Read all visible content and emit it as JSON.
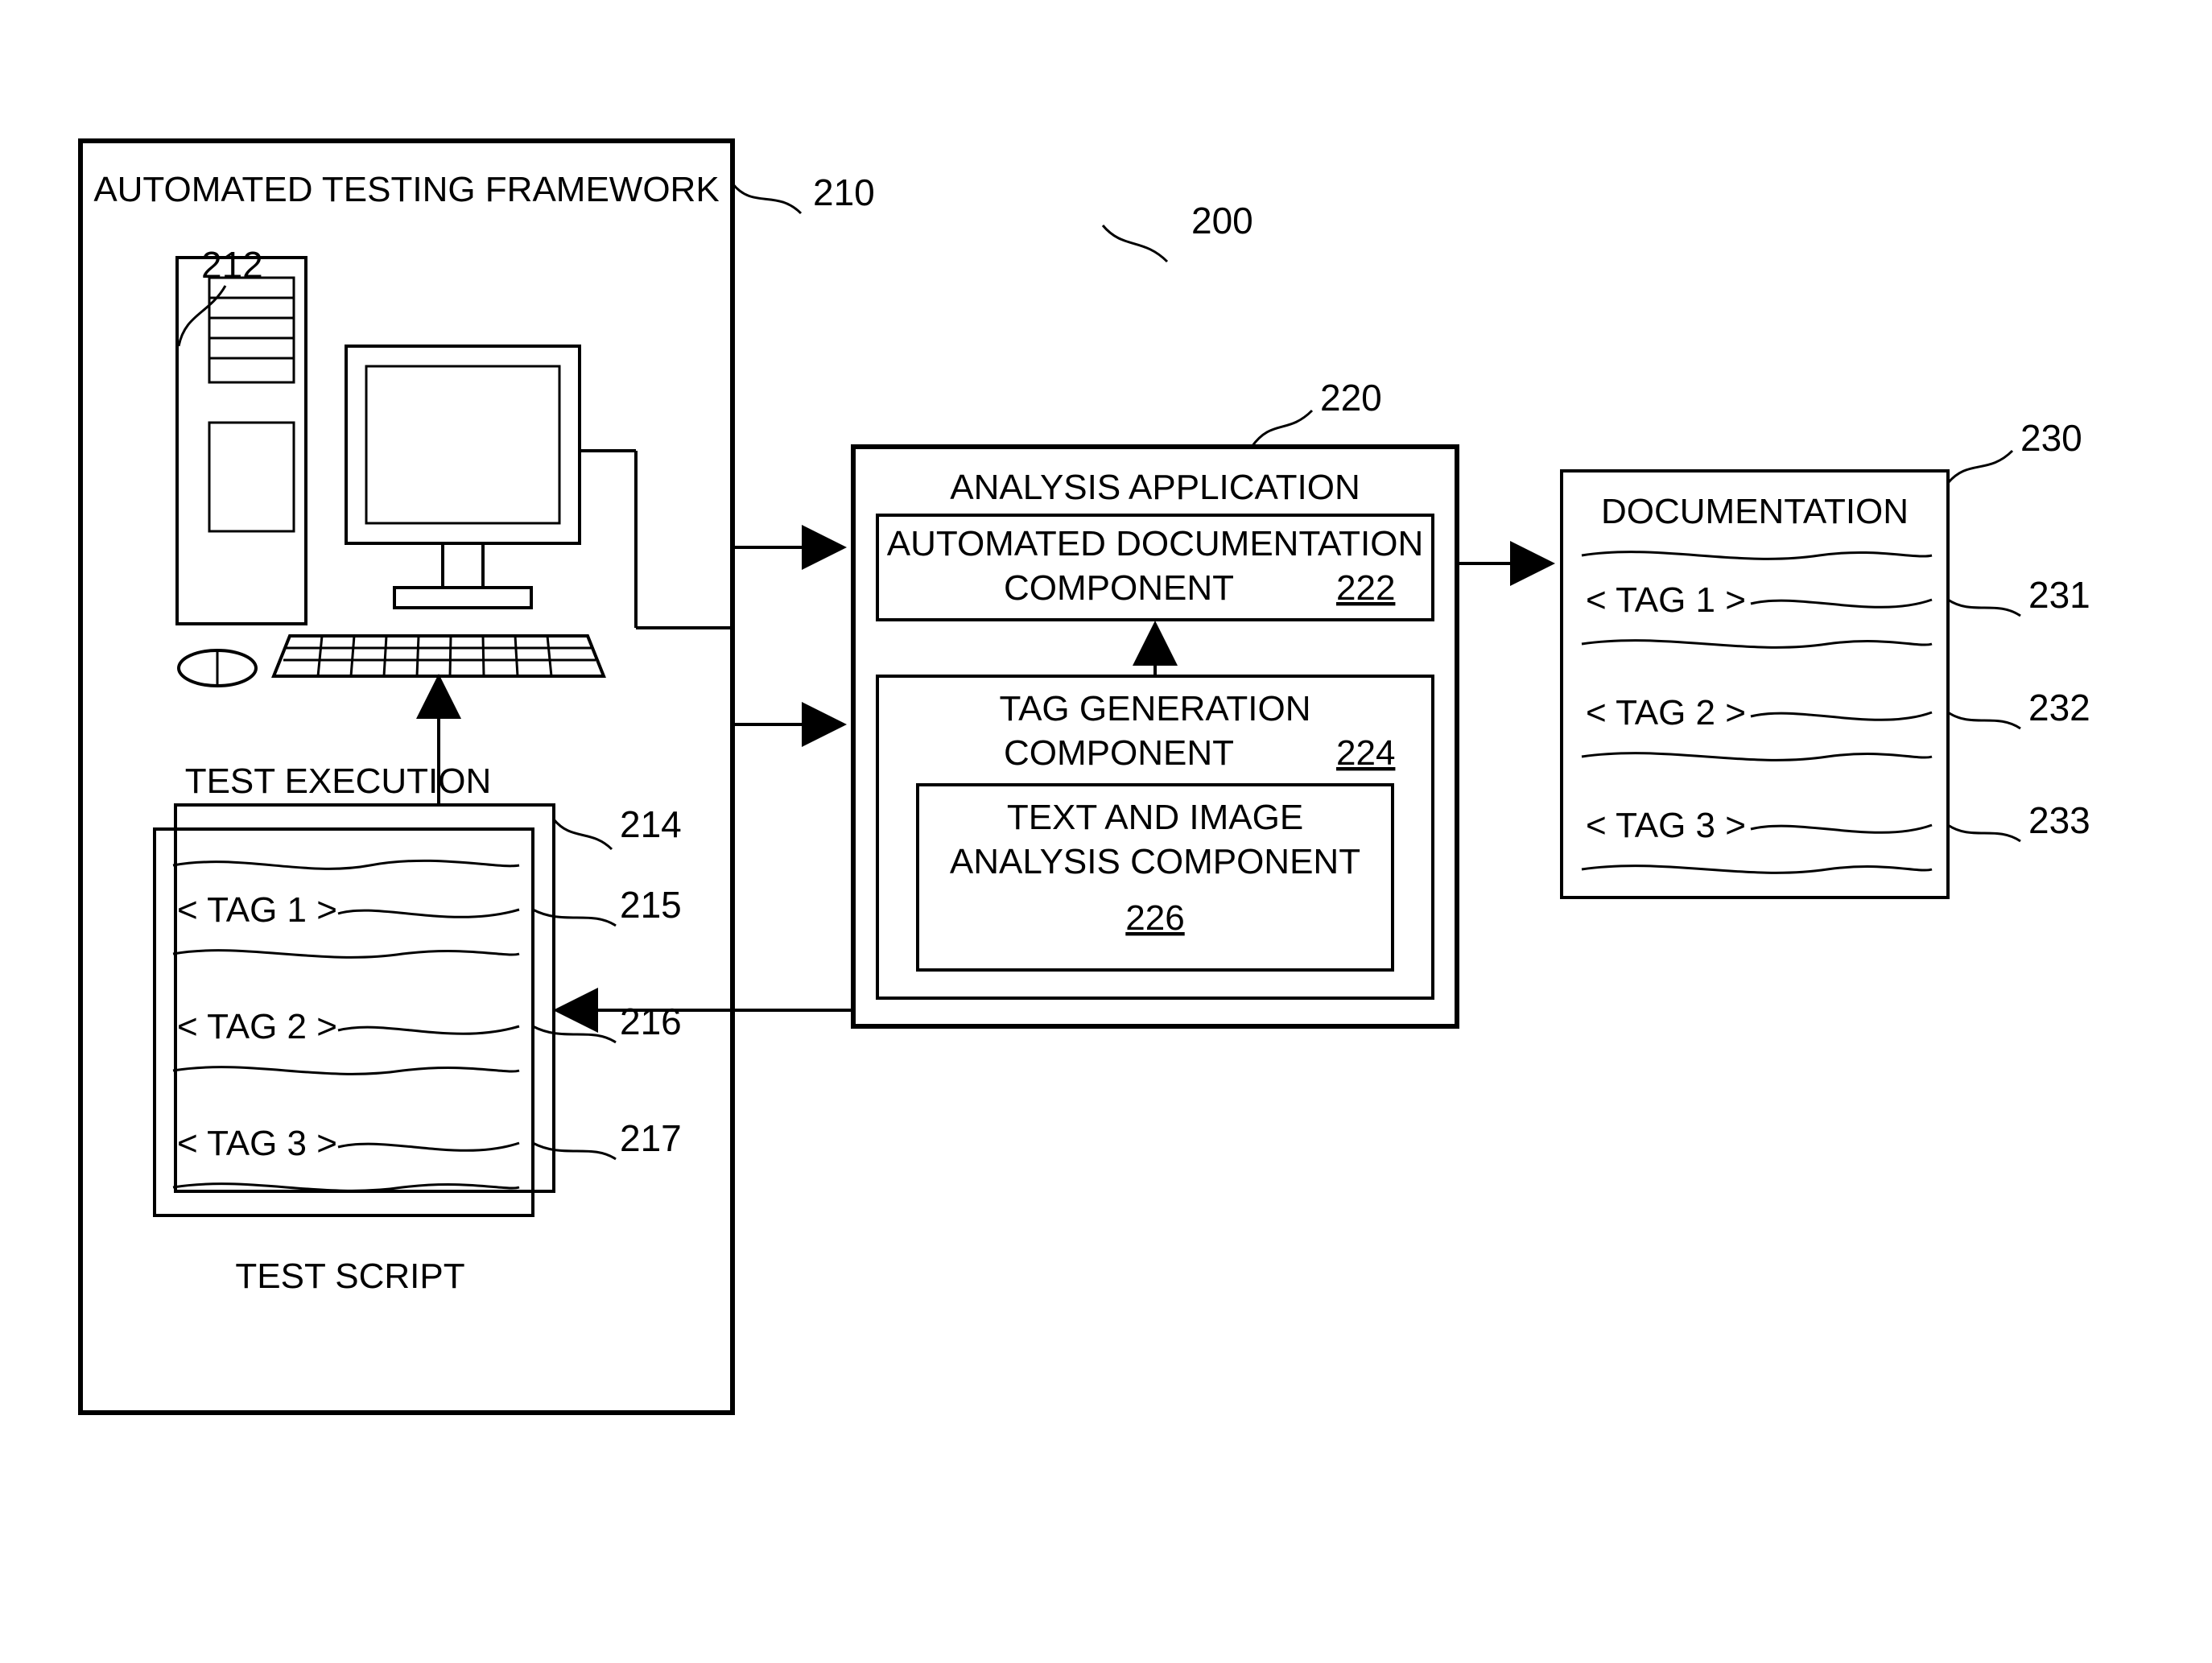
{
  "refs": {
    "r200": "200",
    "r210": "210",
    "r212": "212",
    "r214": "214",
    "r215": "215",
    "r216": "216",
    "r217": "217",
    "r220": "220",
    "r222": "222",
    "r224": "224",
    "r226": "226",
    "r230": "230",
    "r231": "231",
    "r232": "232",
    "r233": "233"
  },
  "labels": {
    "framework": "AUTOMATED TESTING FRAMEWORK",
    "testExec": "TEST EXECUTION",
    "testScript": "TEST SCRIPT",
    "analysisApp": "ANALYSIS APPLICATION",
    "adc1": "AUTOMATED DOCUMENTATION",
    "adc2": "COMPONENT",
    "tgc1": "TAG GENERATION",
    "tgc2": "COMPONENT",
    "tia1": "TEXT AND IMAGE",
    "tia2": "ANALYSIS COMPONENT",
    "doc": "DOCUMENTATION",
    "tag1": "< TAG 1 >",
    "tag2": "< TAG 2 >",
    "tag3": "< TAG 3 >"
  }
}
